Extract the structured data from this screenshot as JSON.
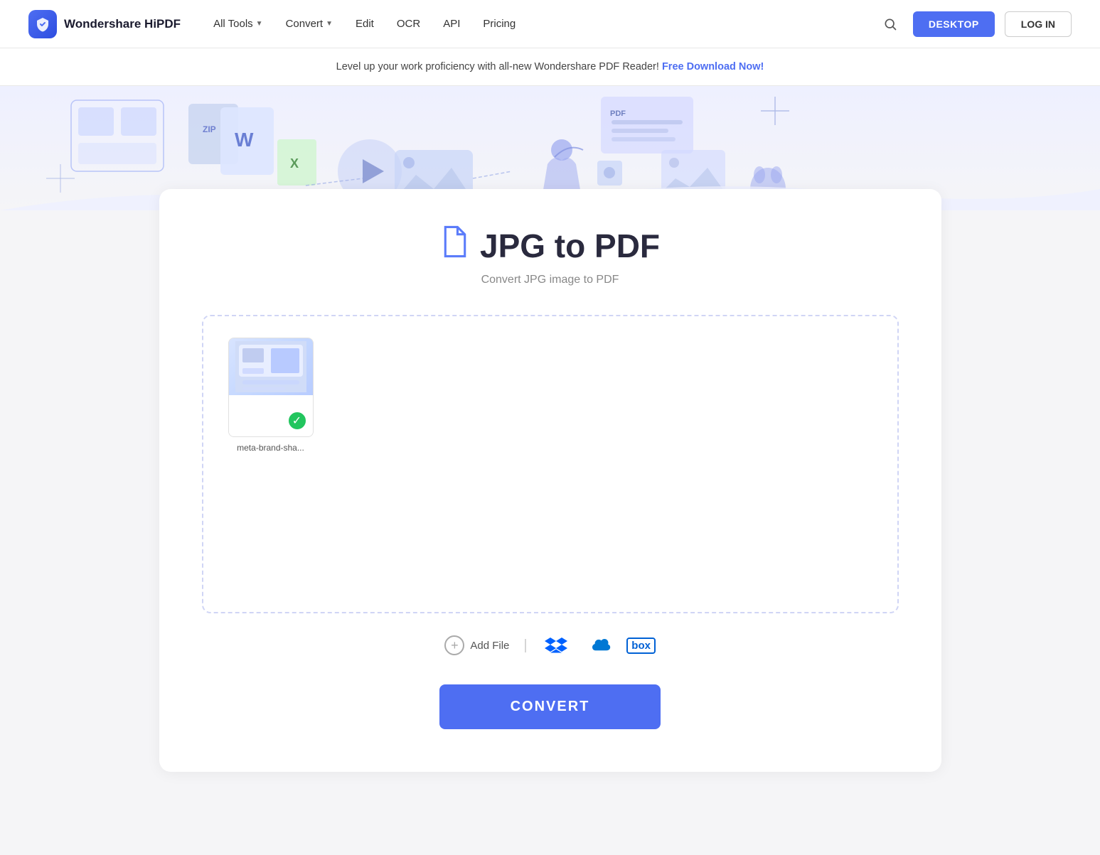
{
  "nav": {
    "logo_text": "Wondershare HiPDF",
    "links": [
      {
        "label": "All Tools",
        "has_dropdown": true
      },
      {
        "label": "Convert",
        "has_dropdown": true
      },
      {
        "label": "Edit",
        "has_dropdown": false
      },
      {
        "label": "OCR",
        "has_dropdown": false
      },
      {
        "label": "API",
        "has_dropdown": false
      },
      {
        "label": "Pricing",
        "has_dropdown": false
      }
    ],
    "desktop_btn": "DESKTOP",
    "login_btn": "LOG IN"
  },
  "banner": {
    "text": "Level up your work proficiency with all-new Wondershare PDF Reader!",
    "cta": "Free Download Now!"
  },
  "page": {
    "title": "JPG to PDF",
    "subtitle": "Convert JPG image to PDF",
    "file_name": "meta-brand-sha...",
    "add_file_label": "Add File",
    "convert_btn": "CONVERT"
  }
}
